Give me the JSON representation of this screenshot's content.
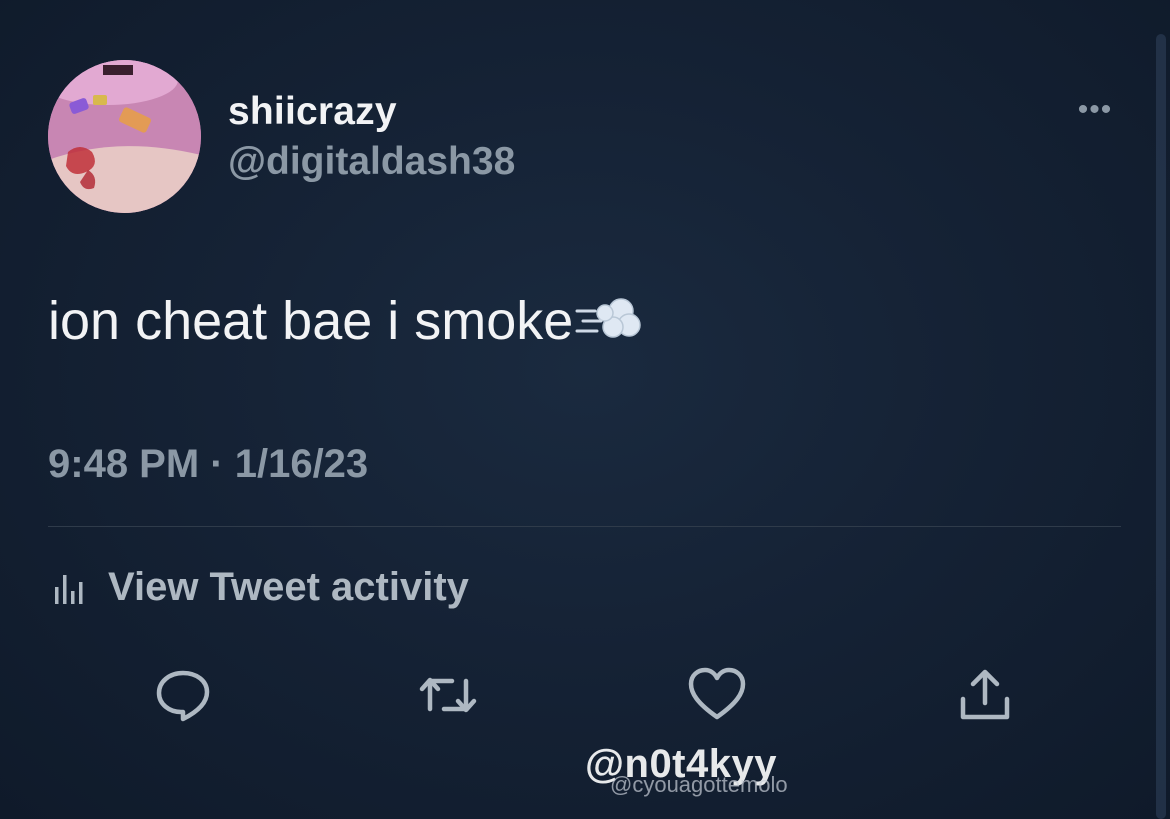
{
  "tweet": {
    "display_name": "shiicrazy",
    "handle": "@digitaldash38",
    "text": "ion cheat bae i smoke",
    "text_emoji": "dash-emoji",
    "timestamp": "9:48 PM · 1/16/23",
    "activity_label": "View Tweet activity",
    "more_label": "•••"
  },
  "actions": {
    "reply_icon": "reply-icon",
    "retweet_icon": "retweet-icon",
    "like_icon": "like-icon",
    "share_icon": "share-icon"
  },
  "watermark": {
    "main": "@n0t4kyy",
    "sub": "@cyouagottemolo"
  },
  "colors": {
    "background": "#152235",
    "primary_text": "#f2f3f5",
    "secondary_text": "#8b98a5",
    "divider": "#2f3b4a"
  }
}
